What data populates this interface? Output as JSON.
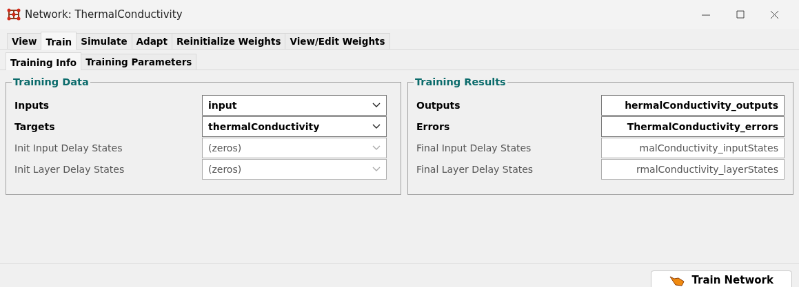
{
  "window": {
    "title": "Network: ThermalConductivity"
  },
  "tabs": [
    {
      "label": "View",
      "selected": false
    },
    {
      "label": "Train",
      "selected": true
    },
    {
      "label": "Simulate",
      "selected": false
    },
    {
      "label": "Adapt",
      "selected": false
    },
    {
      "label": "Reinitialize Weights",
      "selected": false
    },
    {
      "label": "View/Edit Weights",
      "selected": false
    }
  ],
  "subtabs": [
    {
      "label": "Training Info",
      "selected": true
    },
    {
      "label": "Training Parameters",
      "selected": false
    }
  ],
  "training_data": {
    "title": "Training Data",
    "rows": [
      {
        "label": "Inputs",
        "value": "input",
        "disabled": false
      },
      {
        "label": "Targets",
        "value": "thermalConductivity",
        "disabled": false
      },
      {
        "label": "Init Input Delay States",
        "value": "(zeros)",
        "disabled": true
      },
      {
        "label": "Init Layer Delay States",
        "value": "(zeros)",
        "disabled": true
      }
    ]
  },
  "training_results": {
    "title": "Training Results",
    "rows": [
      {
        "label": "Outputs",
        "value": "hermalConductivity_outputs",
        "disabled": false
      },
      {
        "label": "Errors",
        "value": "ThermalConductivity_errors",
        "disabled": false
      },
      {
        "label": "Final Input Delay States",
        "value": "malConductivity_inputStates",
        "disabled": true
      },
      {
        "label": "Final Layer Delay States",
        "value": "rmalConductivity_layerStates",
        "disabled": true
      }
    ]
  },
  "train_button": {
    "label": "Train Network"
  }
}
